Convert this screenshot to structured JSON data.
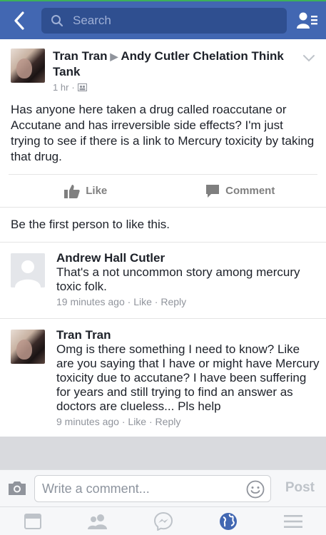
{
  "search": {
    "placeholder": "Search"
  },
  "post": {
    "author": "Tran Tran",
    "group": "Andy Cutler Chelation Think Tank",
    "time": "1 hr",
    "audience_icon": "group-icon",
    "body": "Has anyone here taken a drug called roaccutane or Accutane and has irreversible side effects? I'm just trying to see if there is a link to Mercury toxicity by taking that drug."
  },
  "actions": {
    "like": "Like",
    "comment": "Comment"
  },
  "likes_line": "Be the first person to like this.",
  "comments": [
    {
      "name": "Andrew Hall Cutler",
      "text": "That's a not uncommon story among mercury toxic folk.",
      "time": "19 minutes ago",
      "like": "Like",
      "reply": "Reply"
    },
    {
      "name": "Tran Tran",
      "text": "Omg is there something I need to know? Like are you saying that I have or might have Mercury toxicity due to accutane? I have been suffering for years and still trying to find an answer as doctors are clueless... Pls help",
      "time": "9 minutes ago",
      "like": "Like",
      "reply": "Reply"
    }
  ],
  "composer": {
    "placeholder": "Write a comment...",
    "post": "Post"
  },
  "tabs": [
    "news-feed-icon",
    "friends-icon",
    "messenger-icon",
    "notifications-globe-icon",
    "menu-icon"
  ],
  "colors": {
    "brand": "#4267b2",
    "active_tab": "#4267b2",
    "muted": "#90949c"
  }
}
